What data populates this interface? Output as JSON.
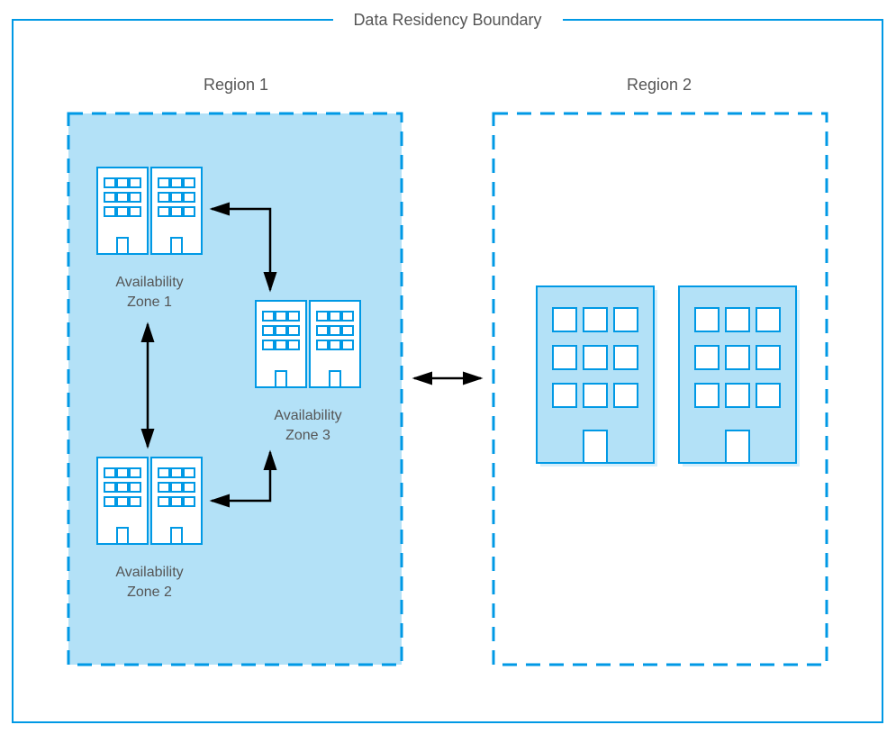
{
  "boundary": {
    "title": "Data Residency Boundary"
  },
  "region1": {
    "title": "Region 1",
    "zones": [
      {
        "name_line1": "Availability",
        "name_line2": "Zone 1"
      },
      {
        "name_line1": "Availability",
        "name_line2": "Zone 2"
      },
      {
        "name_line1": "Availability",
        "name_line2": "Zone 3"
      }
    ]
  },
  "region2": {
    "title": "Region 2"
  },
  "colors": {
    "azure_blue": "#0099e5",
    "region_fill": "#b3e1f7",
    "building_light_fill": "#ffffff",
    "building_large_fill": "#b3e1f7",
    "text": "#555555",
    "arrow": "#000000"
  }
}
